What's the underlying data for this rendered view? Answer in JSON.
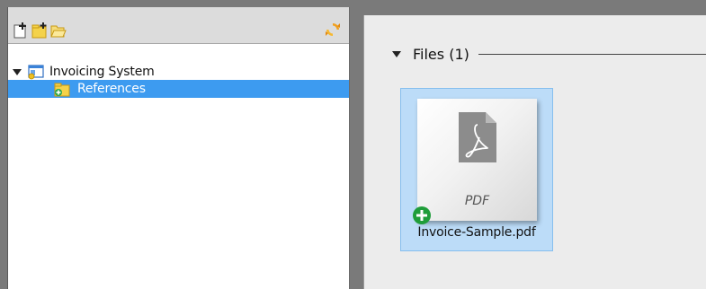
{
  "toolbar": {
    "new_document": "new-document-icon",
    "new_folder": "new-folder-icon",
    "open_folder": "open-folder-icon",
    "refresh": "refresh-icon"
  },
  "tree": {
    "root": {
      "label": "Invoicing System",
      "expanded": true
    },
    "children": [
      {
        "label": "References",
        "selected": true
      }
    ]
  },
  "files_group": {
    "label": "Files (1)",
    "expanded": true,
    "items": [
      {
        "name": "Invoice-Sample.pdf",
        "type_label": "PDF",
        "selected": true
      }
    ]
  },
  "colors": {
    "selection": "#3d9bf0",
    "tile_selection": "#bcdcf8",
    "pane_bg": "#ececec",
    "frame": "#7a7a7a"
  }
}
